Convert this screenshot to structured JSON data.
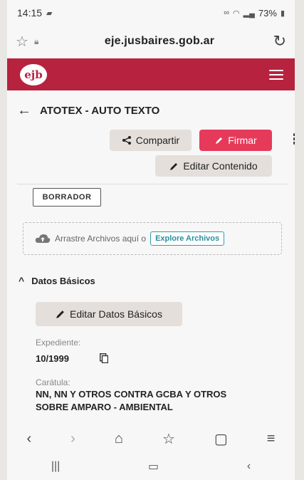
{
  "status_bar": {
    "time": "14:15",
    "battery": "73%"
  },
  "browser": {
    "url": "eje.jusbaires.gob.ar"
  },
  "app": {
    "logo_text": "ejb"
  },
  "page": {
    "title": "ATOTEX - AUTO TEXTO",
    "share_label": "Compartir",
    "sign_label": "Firmar",
    "edit_content_label": "Editar Contenido",
    "status_badge": "BORRADOR",
    "dropzone_text": "Arrastre Archivos aquí o",
    "explore_label": "Explore Archivos"
  },
  "section": {
    "title": "Datos Básicos",
    "edit_label": "Editar Datos Básicos",
    "expediente_label": "Expediente:",
    "expediente_value": "10/1999",
    "caratula_label": "Carátula:",
    "caratula_line1": "NN, NN Y OTROS CONTRA GCBA Y OTROS",
    "caratula_line2": "SOBRE AMPARO - AMBIENTAL"
  },
  "colors": {
    "brand": "#b7233f",
    "sign": "#e63a5a",
    "link": "#2a9fb0"
  },
  "icons": [
    "share-icon",
    "pen-icon",
    "cloud-icon",
    "copy-icon",
    "menu-icon",
    "back-arrow-icon"
  ]
}
